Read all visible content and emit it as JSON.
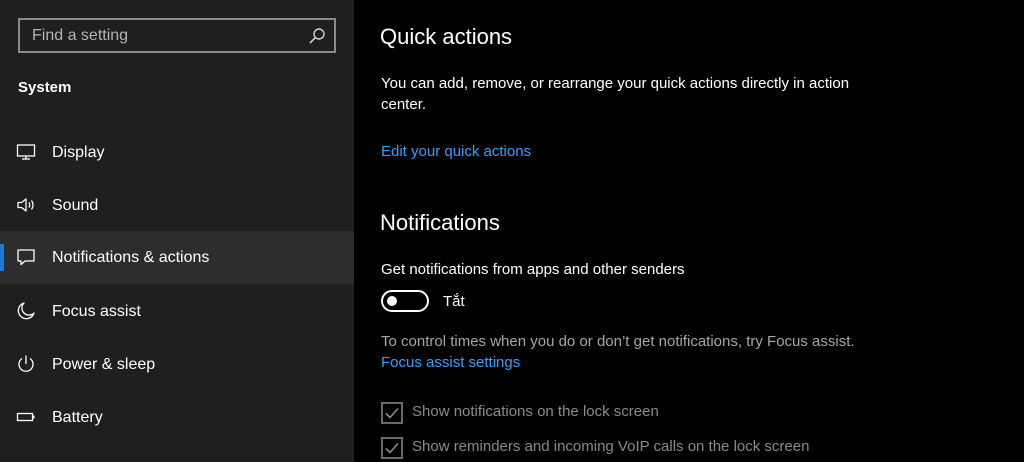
{
  "search": {
    "placeholder": "Find a setting"
  },
  "sidebar": {
    "section_title": "System",
    "items": [
      {
        "label": "Display",
        "icon": "display-icon"
      },
      {
        "label": "Sound",
        "icon": "sound-icon"
      },
      {
        "label": "Notifications & actions",
        "icon": "notifications-icon",
        "selected": true
      },
      {
        "label": "Focus assist",
        "icon": "moon-icon"
      },
      {
        "label": "Power & sleep",
        "icon": "power-icon"
      },
      {
        "label": "Battery",
        "icon": "battery-icon"
      }
    ]
  },
  "main": {
    "quick_actions": {
      "title": "Quick actions",
      "description": "You can add, remove, or rearrange your quick actions directly in action center.",
      "link": "Edit your quick actions"
    },
    "notifications": {
      "title": "Notifications",
      "toggle_label": "Get notifications from apps and other senders",
      "toggle_state": "Tắt",
      "toggle_on": false,
      "focus_text": "To control times when you do or don’t get notifications, try Focus assist.",
      "focus_link": "Focus assist settings",
      "checkboxes": [
        {
          "label": "Show notifications on the lock screen",
          "checked": true,
          "disabled": true
        },
        {
          "label": "Show reminders and incoming VoIP calls on the lock screen",
          "checked": true,
          "disabled": true
        }
      ]
    }
  },
  "colors": {
    "accent": "#1e78d7",
    "link": "#3b9df5",
    "sidebar_bg": "#1f1f1f",
    "selected_bg": "#2d2d2d"
  }
}
